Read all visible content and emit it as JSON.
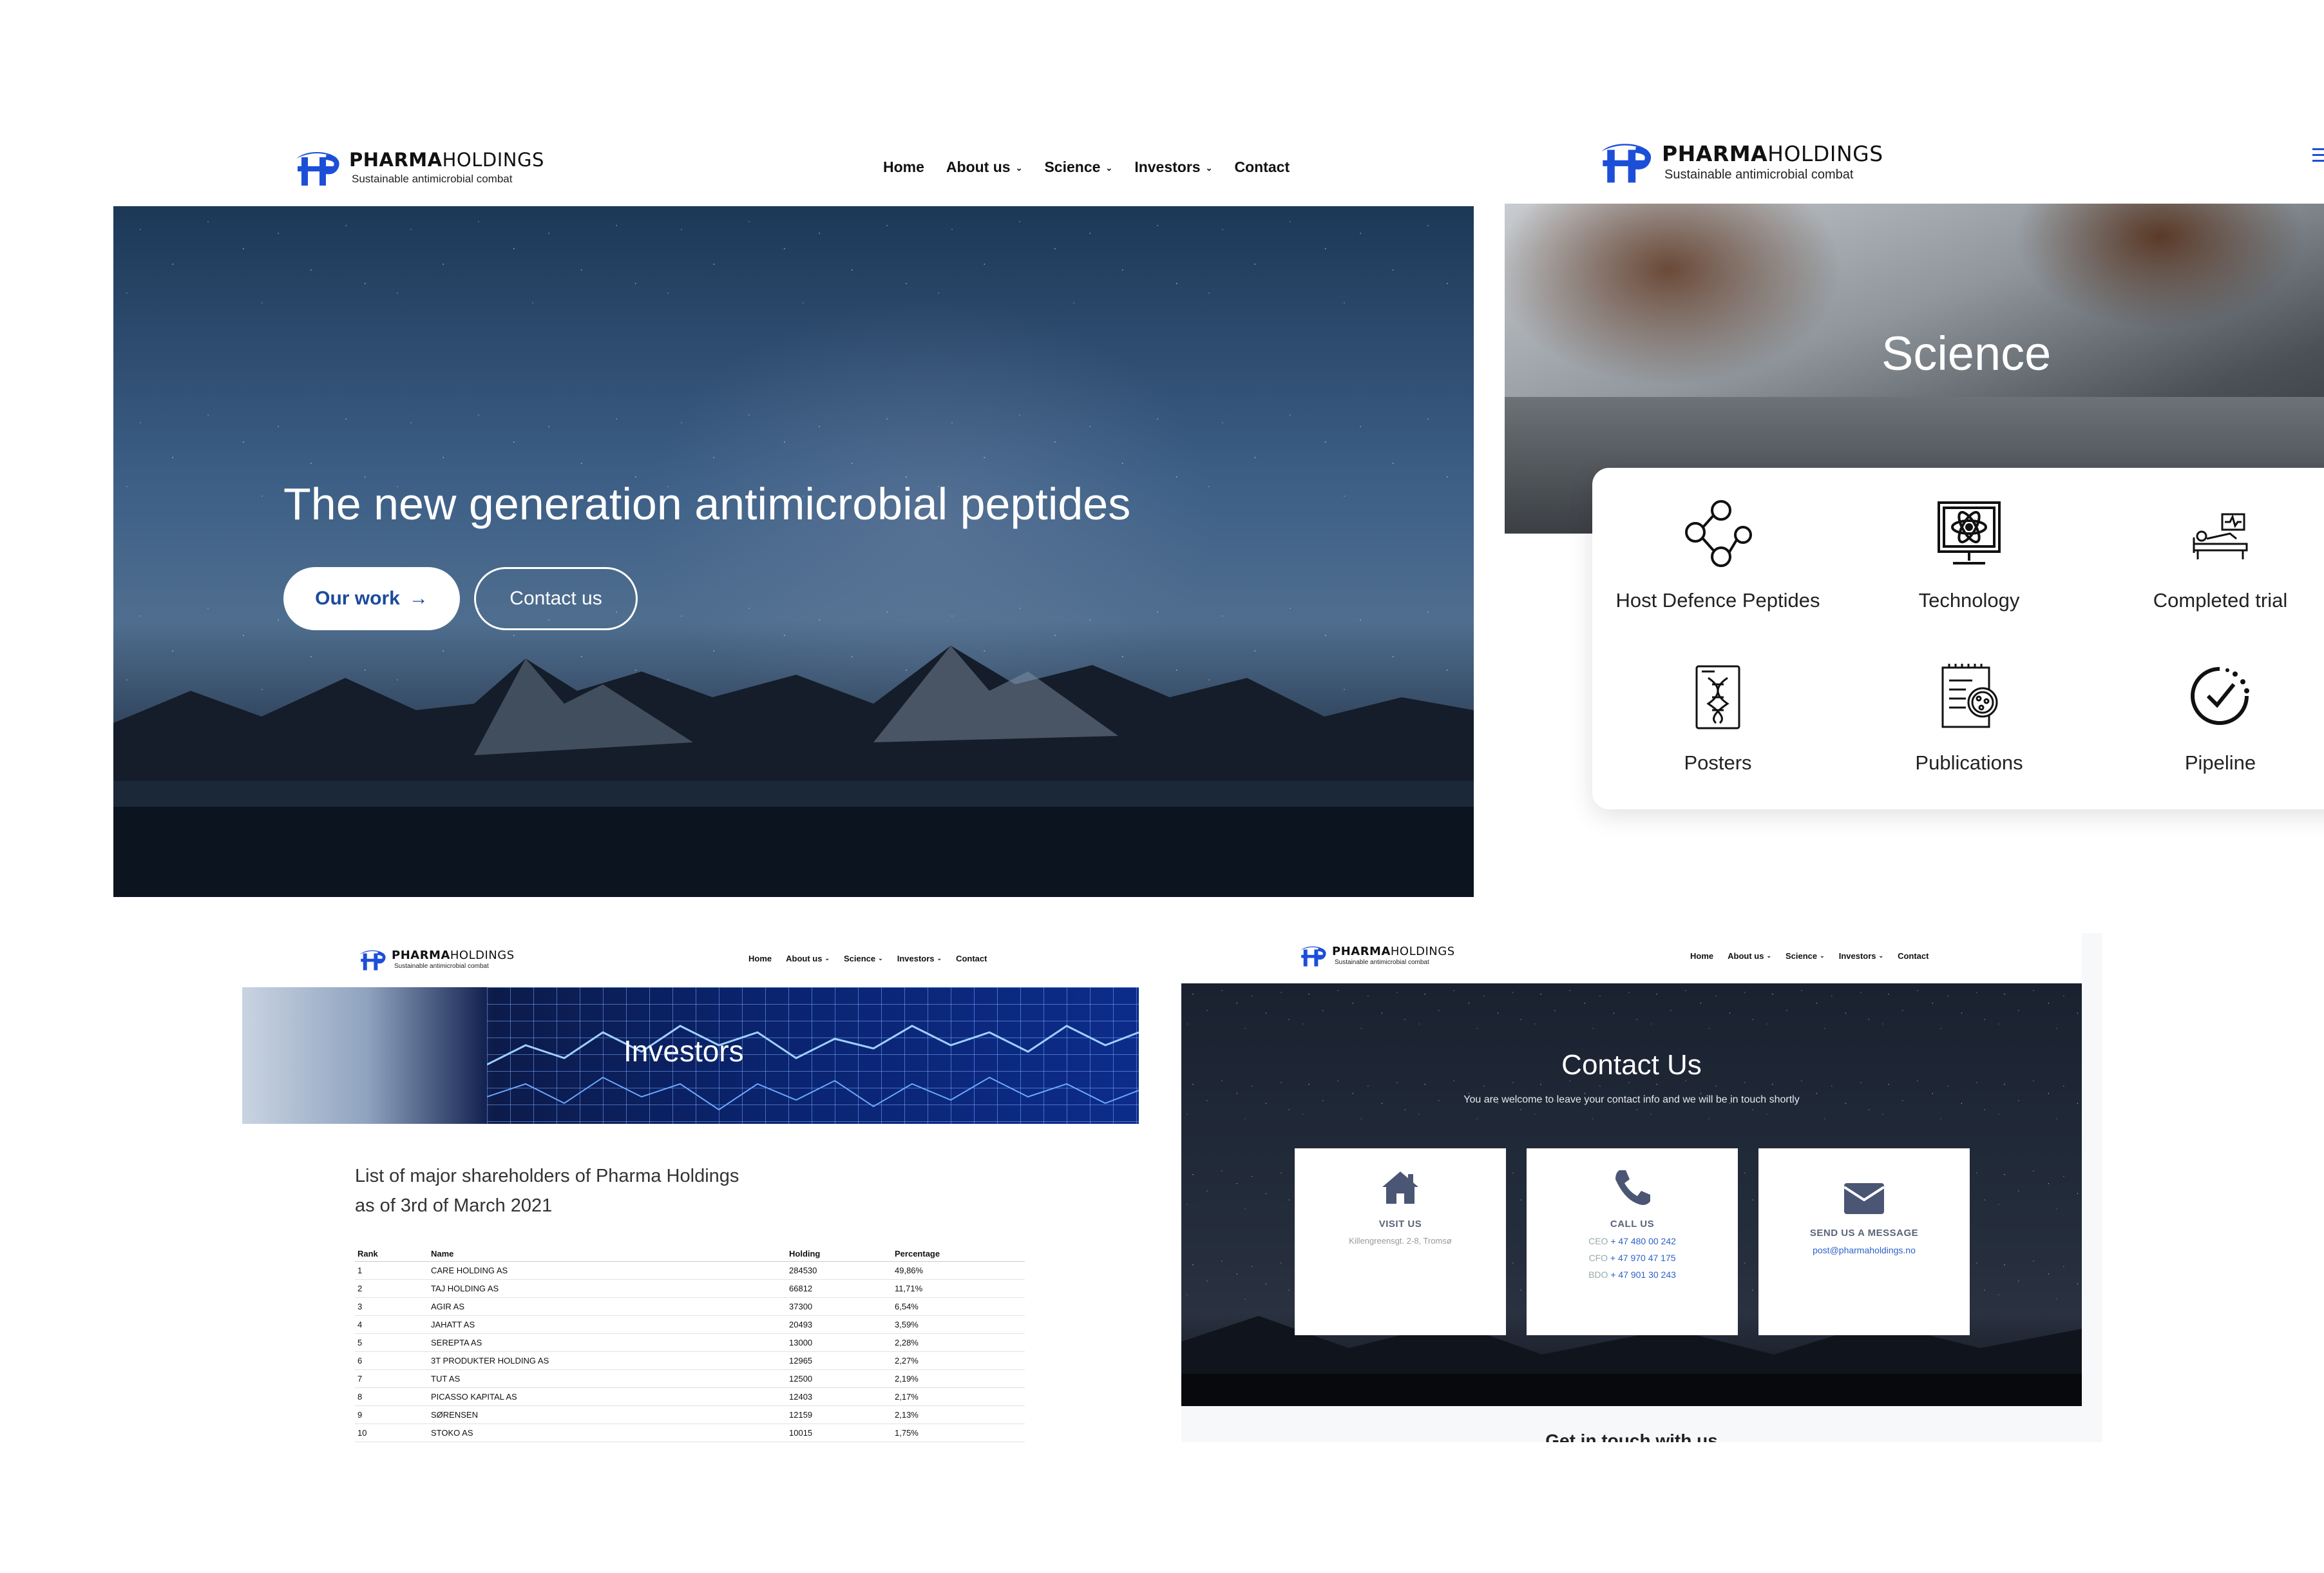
{
  "brand": {
    "name_bold": "PHARMA",
    "name_light": "HOLDINGS",
    "tagline": "Sustainable antimicrobial combat",
    "color": "#1c4fd8"
  },
  "nav": {
    "home": "Home",
    "about": "About us",
    "science": "Science",
    "investors": "Investors",
    "contact": "Contact"
  },
  "hero": {
    "title": "The new generation antimicrobial peptides",
    "btn_work": "Our work",
    "btn_work_arrow": "→",
    "btn_contact": "Contact us"
  },
  "science": {
    "title": "Science",
    "items": [
      {
        "label": "Host Defence Peptides",
        "icon": "molecule-icon"
      },
      {
        "label": "Technology",
        "icon": "monitor-atom-icon"
      },
      {
        "label": "Completed trial",
        "icon": "hospital-bed-icon"
      },
      {
        "label": "Posters",
        "icon": "dna-poster-icon"
      },
      {
        "label": "Publications",
        "icon": "notepad-petri-icon"
      },
      {
        "label": "Pipeline",
        "icon": "clock-check-icon"
      }
    ]
  },
  "investors": {
    "title": "Investors",
    "heading_line1": "List of major shareholders of Pharma Holdings",
    "heading_line2": "as of 3rd of March 2021",
    "columns": [
      "Rank",
      "Name",
      "Holding",
      "Percentage"
    ],
    "rows": [
      [
        "1",
        "CARE HOLDING AS",
        "284530",
        "49,86%"
      ],
      [
        "2",
        "TAJ HOLDING AS",
        "66812",
        "11,71%"
      ],
      [
        "3",
        "AGIR AS",
        "37300",
        "6,54%"
      ],
      [
        "4",
        "JAHATT AS",
        "20493",
        "3,59%"
      ],
      [
        "5",
        "SEREPTA AS",
        "13000",
        "2,28%"
      ],
      [
        "6",
        "3T PRODUKTER HOLDING AS",
        "12965",
        "2,27%"
      ],
      [
        "7",
        "TUT AS",
        "12500",
        "2,19%"
      ],
      [
        "8",
        "PICASSO KAPITAL AS",
        "12403",
        "2,17%"
      ],
      [
        "9",
        "SØRENSEN",
        "12159",
        "2,13%"
      ],
      [
        "10",
        "STOKO AS",
        "10015",
        "1,75%"
      ]
    ]
  },
  "contact": {
    "title": "Contact Us",
    "subtitle": "You are welcome to leave your contact info and we will be in touch shortly",
    "visit_title": "VISIT US",
    "visit_address": "Killengreensgt. 2-8, Tromsø",
    "call_title": "CALL US",
    "call_ceo_label": "CEO",
    "call_ceo": "+ 47 480 00 242",
    "call_cfo_label": "CFO",
    "call_cfo": "+ 47 970 47 175",
    "call_bdo_label": "BDO",
    "call_bdo": "+ 47 901 30 243",
    "message_title": "SEND US A MESSAGE",
    "message_email": "post@pharmaholdings.no",
    "footer_heading": "Get in touch with us"
  }
}
